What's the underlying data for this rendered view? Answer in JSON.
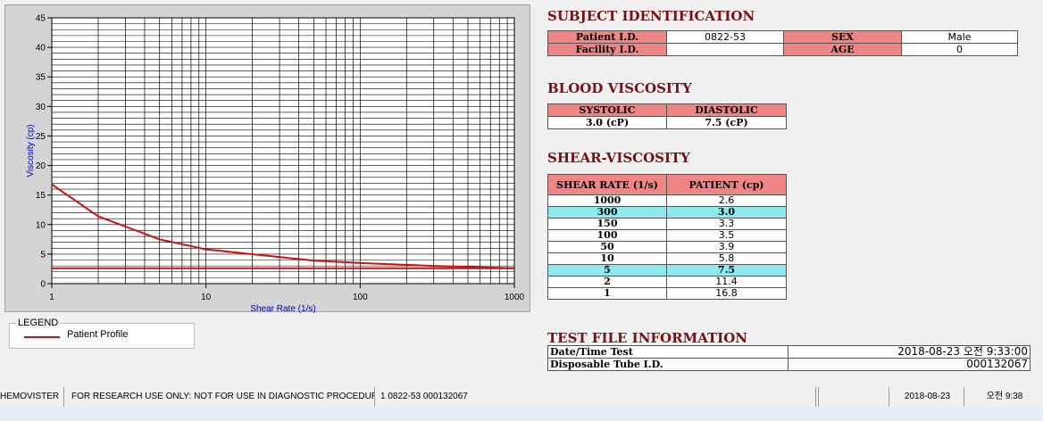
{
  "chart_data": {
    "type": "line",
    "xlabel": "Shear Rate (1/s)",
    "ylabel": "Viscosity (cp)",
    "x_scale": "log",
    "xlim": [
      1,
      1000
    ],
    "ylim": [
      0,
      45
    ],
    "x_ticks": [
      "1",
      "10",
      "100",
      "1000"
    ],
    "y_ticks": [
      "0",
      "5",
      "10",
      "15",
      "20",
      "25",
      "30",
      "35",
      "40",
      "45"
    ],
    "grid": true,
    "series": [
      {
        "name": "Patient Profile",
        "color": "#cc1111",
        "x": [
          1,
          2,
          5,
          10,
          50,
          100,
          150,
          300,
          1000
        ],
        "y": [
          16.8,
          11.4,
          7.5,
          5.8,
          3.9,
          3.5,
          3.3,
          3.0,
          2.6
        ]
      },
      {
        "color": "#cc1111",
        "x": [
          1,
          1000
        ],
        "y": [
          2.6,
          2.6
        ]
      }
    ]
  },
  "legend": {
    "title": "LEGEND",
    "label": "Patient Profile",
    "color": "#cc1111"
  },
  "subject": {
    "title": "SUBJECT IDENTIFICATION",
    "patient_id_label": "Patient I.D.",
    "patient_id": "0822-53",
    "sex_label": "SEX",
    "sex": "Male",
    "facility_label": "Facility I.D.",
    "facility": "",
    "age_label": "AGE",
    "age": "0"
  },
  "blood": {
    "title": "BLOOD VISCOSITY",
    "systolic_label": "SYSTOLIC",
    "systolic": "3.0 (cP)",
    "diastolic_label": "DIASTOLIC",
    "diastolic": "7.5 (cP)"
  },
  "shear": {
    "title": "SHEAR-VISCOSITY",
    "col1": "SHEAR RATE (1/s)",
    "col2": "PATIENT (cp)",
    "rows": [
      {
        "rate": "1000",
        "value": "2.6"
      },
      {
        "rate": "300",
        "value": "3.0"
      },
      {
        "rate": "150",
        "value": "3.3"
      },
      {
        "rate": "100",
        "value": "3.5"
      },
      {
        "rate": "50",
        "value": "3.9"
      },
      {
        "rate": "10",
        "value": "5.8"
      },
      {
        "rate": "5",
        "value": "7.5"
      },
      {
        "rate": "2",
        "value": "11.4"
      },
      {
        "rate": "1",
        "value": "16.8"
      }
    ],
    "highlight_color": "#8ee8ee"
  },
  "testfile": {
    "title": "TEST FILE INFORMATION",
    "datetime_label": "Date/Time Test",
    "datetime": "2018-08-23  오전 9:33:00",
    "tube_label": "Disposable Tube I.D.",
    "tube": "000132067"
  },
  "status": {
    "app": "HEMOVISTER",
    "notice": "FOR RESEARCH USE ONLY: NOT FOR USE IN DIAGNOSTIC PROCEDURES",
    "info": "1  0822-53  000132067",
    "date": "2018-08-23",
    "time": "오전 9:38"
  },
  "colors": {
    "header_bg": "#f08585",
    "title": "#7a1010",
    "plot_bg": "#ffffff"
  }
}
